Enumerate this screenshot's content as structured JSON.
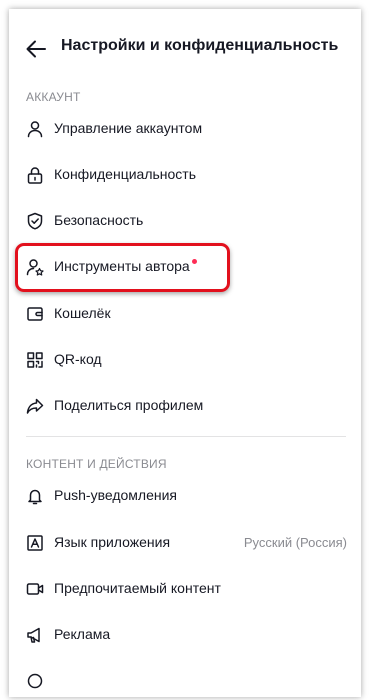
{
  "header": {
    "back_icon": "arrow-left-icon",
    "title": "Настройки и конфиденциальность"
  },
  "sections": [
    {
      "title": "АККАУНТ",
      "items": [
        {
          "label": "Управление аккаунтом",
          "icon": "user-icon"
        },
        {
          "label": "Конфиденциальность",
          "icon": "lock-icon"
        },
        {
          "label": "Безопасность",
          "icon": "shield-icon"
        },
        {
          "label": "Инструменты автора",
          "icon": "creator-tools-icon",
          "badge_dot": true
        },
        {
          "label": "Кошелёк",
          "icon": "wallet-icon"
        },
        {
          "label": "QR-код",
          "icon": "qr-code-icon"
        },
        {
          "label": "Поделиться профилем",
          "icon": "share-icon"
        }
      ]
    },
    {
      "title": "КОНТЕНТ И ДЕЙСТВИЯ",
      "items": [
        {
          "label": "Push-уведомления",
          "icon": "bell-icon"
        },
        {
          "label": "Язык приложения",
          "icon": "language-icon",
          "value": "Русский (Россия)"
        },
        {
          "label": "Предпочитаемый контент",
          "icon": "video-camera-icon"
        },
        {
          "label": "Реклама",
          "icon": "megaphone-icon"
        }
      ]
    }
  ],
  "colors": {
    "text": "#161823",
    "secondary_text": "#8a8b91",
    "badge_dot": "#fe2c55",
    "highlight_outline": "#e2101d",
    "divider": "#e3e3e4"
  }
}
